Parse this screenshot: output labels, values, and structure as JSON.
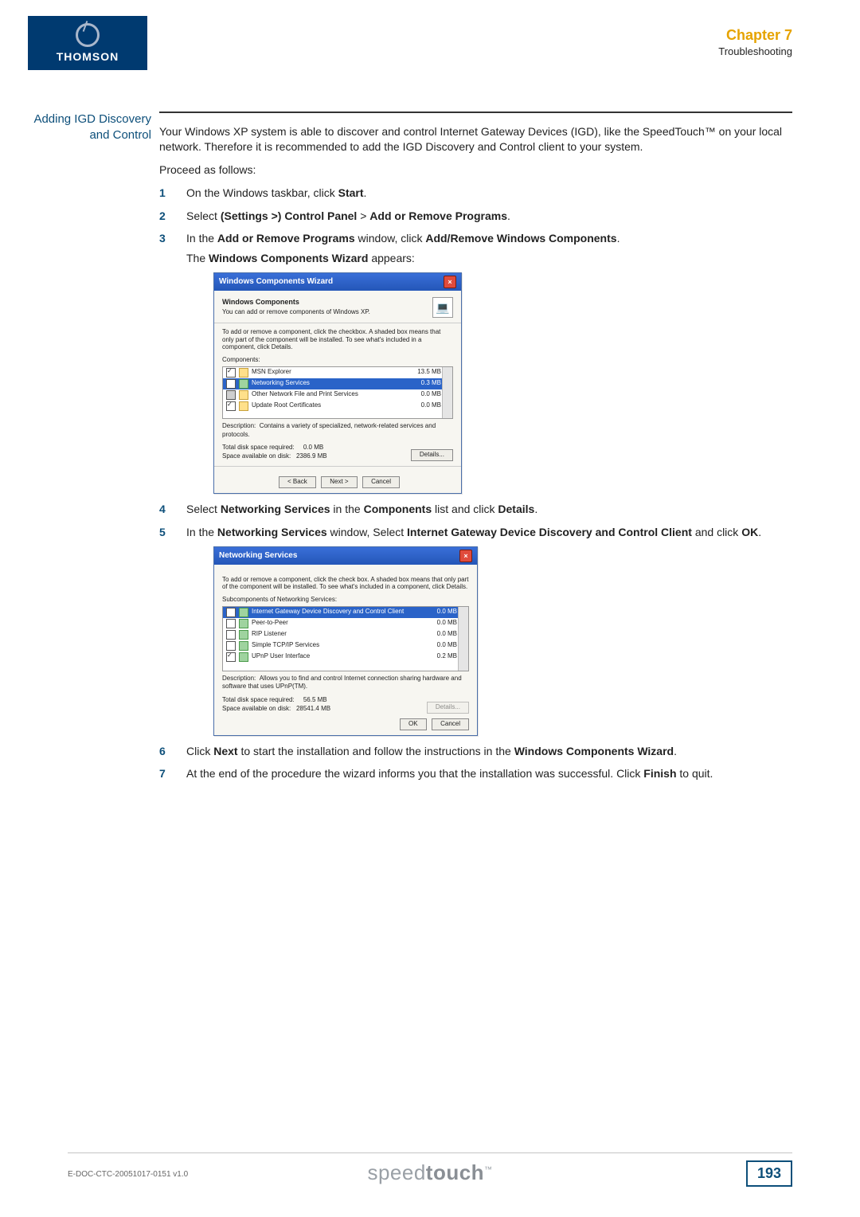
{
  "header": {
    "logo_text": "THOMSON",
    "chapter": "Chapter 7",
    "section": "Troubleshooting"
  },
  "sidehead": "Adding IGD Discovery and Control",
  "intro1": "Your Windows XP system is able to discover and control Internet Gateway Devices (IGD), like the SpeedTouch™ on your local network. Therefore it is recommended to add the IGD Discovery and Control client to your system.",
  "intro2": "Proceed as follows:",
  "steps": {
    "1": {
      "pre": "On the Windows taskbar, click ",
      "b1": "Start",
      "post": "."
    },
    "2": {
      "pre": "Select ",
      "b1": "(Settings >) Control Panel",
      "mid": " > ",
      "b2": "Add or Remove Programs",
      "post": "."
    },
    "3": {
      "pre": "In the ",
      "b1": "Add or Remove Programs",
      "mid": " window, click ",
      "b2": "Add/Remove Windows Components",
      "post1": ".",
      "line2a": "The ",
      "line2b": "Windows Components Wizard",
      "line2c": " appears:"
    },
    "4": {
      "pre": "Select ",
      "b1": "Networking Services",
      "mid": " in the ",
      "b2": "Components",
      "mid2": " list and click ",
      "b3": "Details",
      "post": "."
    },
    "5": {
      "pre": "In the ",
      "b1": "Networking Services",
      "mid": " window, Select ",
      "b2": "Internet Gateway Device Discovery and Control Client",
      "mid2": " and click ",
      "b3": "OK",
      "post": "."
    },
    "6": {
      "pre": "Click ",
      "b1": "Next",
      "mid": " to start the installation and follow the instructions in the ",
      "b2": "Windows Components Wizard",
      "post": "."
    },
    "7": {
      "pre": "At the end of the procedure the wizard informs you that the installation was successful. Click ",
      "b1": "Finish",
      "post": " to quit."
    }
  },
  "dlg1": {
    "title": "Windows Components Wizard",
    "heading": "Windows Components",
    "sub": "You can add or remove components of Windows XP.",
    "instruction": "To add or remove a component, click the checkbox. A shaded box means that only part of the component will be installed. To see what's included in a component, click Details.",
    "list_label": "Components:",
    "rows": [
      {
        "checked": true,
        "name": "MSN Explorer",
        "size": "13.5 MB"
      },
      {
        "checked": true,
        "name": "Networking Services",
        "size": "0.3 MB",
        "selected": true
      },
      {
        "checked": false,
        "name": "Other Network File and Print Services",
        "size": "0.0 MB",
        "shaded": true
      },
      {
        "checked": true,
        "name": "Update Root Certificates",
        "size": "0.0 MB"
      }
    ],
    "desc_label": "Description:",
    "desc_value": "Contains a variety of specialized, network-related services and protocols.",
    "disk_req_label": "Total disk space required:",
    "disk_req_value": "0.0 MB",
    "disk_avail_label": "Space available on disk:",
    "disk_avail_value": "2386.9 MB",
    "btn_details": "Details...",
    "btn_back": "< Back",
    "btn_next": "Next >",
    "btn_cancel": "Cancel"
  },
  "dlg2": {
    "title": "Networking Services",
    "instruction": "To add or remove a component, click the check box. A shaded box means that only part of the component will be installed. To see what's included in a component, click Details.",
    "list_label": "Subcomponents of Networking Services:",
    "rows": [
      {
        "checked": true,
        "name": "Internet Gateway Device Discovery and Control Client",
        "size": "0.0 MB",
        "selected": true
      },
      {
        "checked": false,
        "name": "Peer-to-Peer",
        "size": "0.0 MB"
      },
      {
        "checked": false,
        "name": "RIP Listener",
        "size": "0.0 MB"
      },
      {
        "checked": false,
        "name": "Simple TCP/IP Services",
        "size": "0.0 MB"
      },
      {
        "checked": true,
        "name": "UPnP User Interface",
        "size": "0.2 MB"
      }
    ],
    "desc_label": "Description:",
    "desc_value": "Allows you to find and control Internet connection sharing hardware and software that uses UPnP(TM).",
    "disk_req_label": "Total disk space required:",
    "disk_req_value": "56.5 MB",
    "disk_avail_label": "Space available on disk:",
    "disk_avail_value": "28541.4 MB",
    "btn_details": "Details...",
    "btn_ok": "OK",
    "btn_cancel": "Cancel"
  },
  "footer": {
    "doc_id": "E-DOC-CTC-20051017-0151 v1.0",
    "brand_a": "speed",
    "brand_b": "touch",
    "tm": "™",
    "page_no": "193"
  }
}
